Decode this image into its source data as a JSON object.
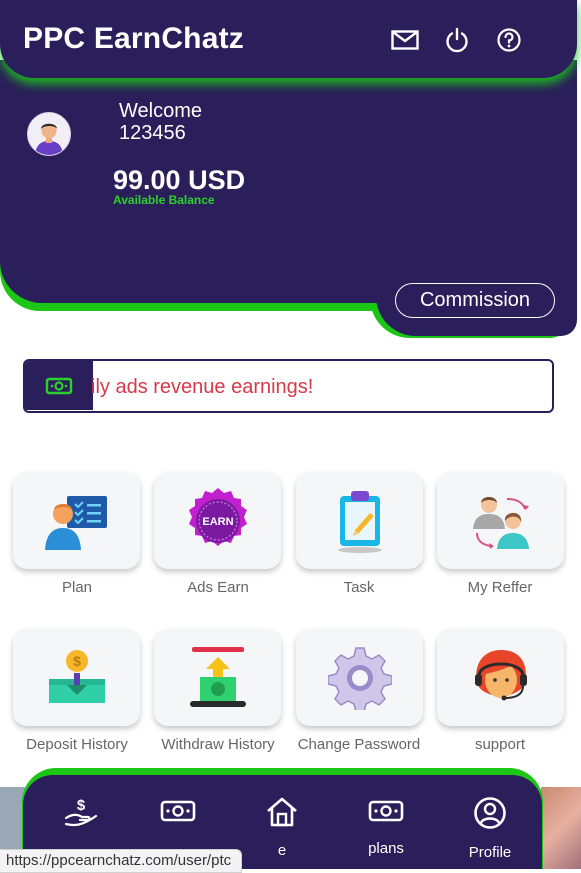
{
  "header": {
    "app_title": "PPC EarnChatz",
    "icons": [
      "mail-icon",
      "power-icon",
      "help-icon"
    ]
  },
  "account": {
    "welcome": "Welcome",
    "user_id": "123456",
    "balance": "99.00 USD",
    "balance_label": "Available Balance",
    "commission_label": "Commission"
  },
  "marquee": {
    "text": "ily ads revenue earnings!"
  },
  "menu": {
    "row1": [
      "Plan",
      "Ads Earn",
      "Task",
      "My Reffer"
    ],
    "row2": [
      "Deposit History",
      "Withdraw History",
      "Change Password",
      "support"
    ],
    "earn_badge": "EARN",
    "deposit_coin": "$"
  },
  "bottom_nav": {
    "items": [
      "",
      "",
      "e",
      "plans",
      "Profile"
    ]
  },
  "status_url": "https://ppcearnchatz.com/user/ptc",
  "colors": {
    "primary": "#2a1f5a",
    "accent_green": "#1bc614",
    "marquee_text": "#d8394a",
    "balance_label": "#2bd12a"
  }
}
